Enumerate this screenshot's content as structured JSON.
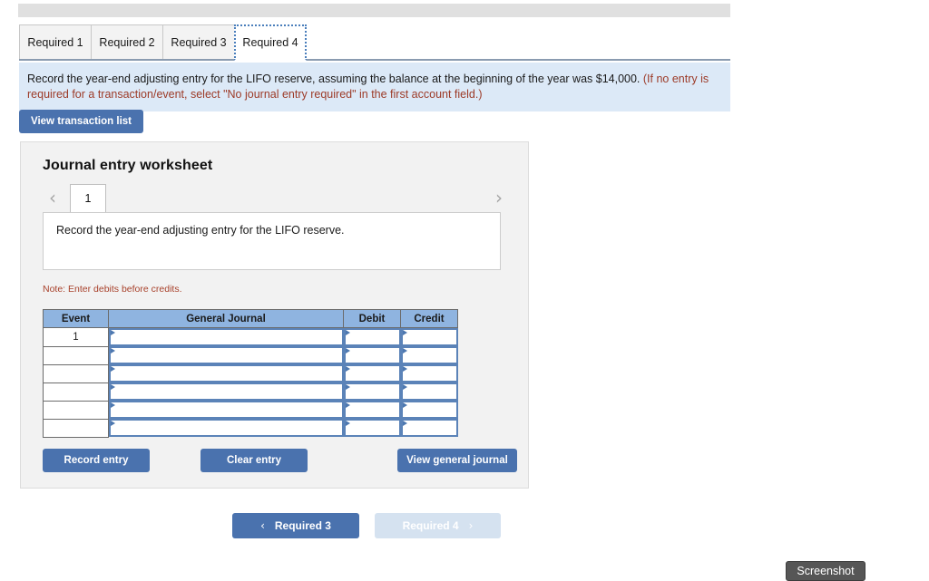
{
  "tabs": [
    {
      "label": "Required 1",
      "active": false
    },
    {
      "label": "Required 2",
      "active": false
    },
    {
      "label": "Required 3",
      "active": false
    },
    {
      "label": "Required 4",
      "active": true
    }
  ],
  "instruction": {
    "main": "Record the year-end adjusting entry for the LIFO reserve, assuming the balance at the beginning of the year was $14,000. ",
    "note": "(If no entry is required for a transaction/event, select \"No journal entry required\" in the first account field.)"
  },
  "toolbar": {
    "view_transaction_list_label": "View transaction list"
  },
  "worksheet": {
    "title": "Journal entry worksheet",
    "pager": {
      "prev_icon": "‹",
      "next_icon": "›",
      "pages": [
        "1"
      ],
      "current": "1"
    },
    "description": "Record the year-end adjusting entry for the LIFO reserve.",
    "note": "Note: Enter debits before credits.",
    "table": {
      "columns": [
        "Event",
        "General Journal",
        "Debit",
        "Credit"
      ],
      "rows": [
        {
          "event": "1",
          "general_journal": "",
          "debit": "",
          "credit": ""
        },
        {
          "event": "",
          "general_journal": "",
          "debit": "",
          "credit": ""
        },
        {
          "event": "",
          "general_journal": "",
          "debit": "",
          "credit": ""
        },
        {
          "event": "",
          "general_journal": "",
          "debit": "",
          "credit": ""
        },
        {
          "event": "",
          "general_journal": "",
          "debit": "",
          "credit": ""
        },
        {
          "event": "",
          "general_journal": "",
          "debit": "",
          "credit": ""
        }
      ]
    },
    "actions": {
      "record_entry": "Record entry",
      "clear_entry": "Clear entry",
      "view_general_journal": "View general journal"
    }
  },
  "bottom_nav": {
    "prev_label": "Required 3",
    "prev_icon": "‹",
    "next_label": "Required 4",
    "next_icon": "›",
    "next_disabled": true
  },
  "screenshot_button": {
    "label": "Screenshot"
  },
  "colors": {
    "accent_blue": "#4a72ae",
    "table_header_blue": "#8fb4e0",
    "instruction_bg": "#dce9f7",
    "instruction_red": "#9c3a27",
    "note_red": "#a8412b",
    "panel_bg": "#f2f2f2",
    "disabled_blue": "#d5e2f0",
    "screenshot_bg": "#565656"
  }
}
